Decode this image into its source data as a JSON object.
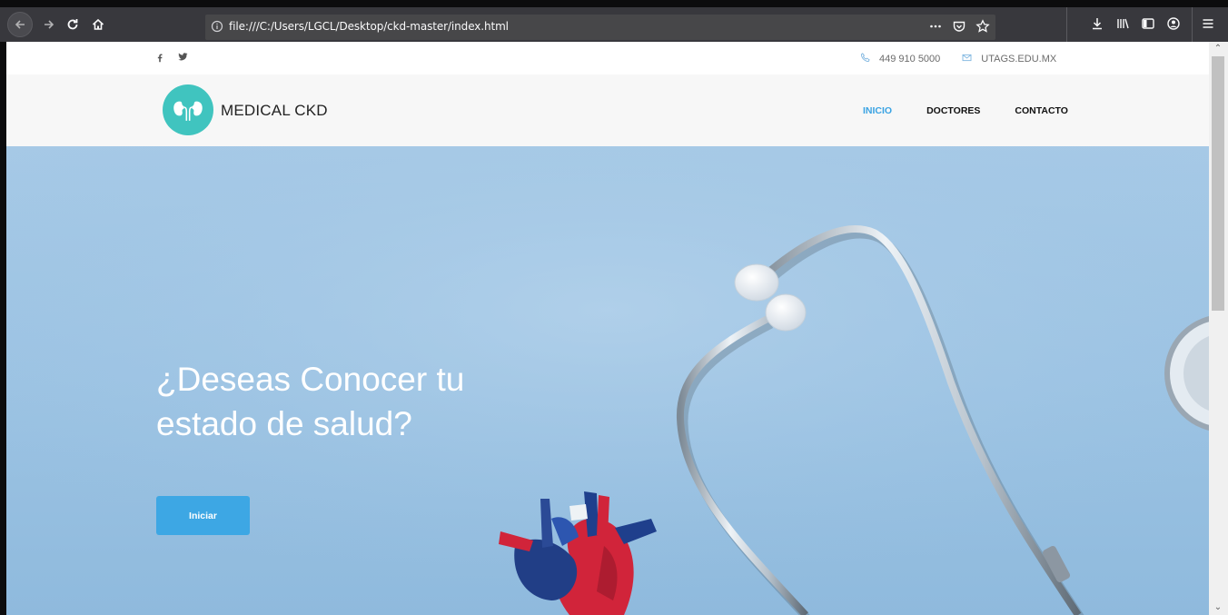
{
  "browser": {
    "url": "file:///C:/Users/LGCL/Desktop/ckd-master/index.html"
  },
  "topbar": {
    "phone": "449 910 5000",
    "email": "UTAGS.EDU.MX"
  },
  "header": {
    "brand": "MEDICAL CKD",
    "nav": [
      {
        "label": "INICIO",
        "active": true
      },
      {
        "label": "DOCTORES",
        "active": false
      },
      {
        "label": "CONTACTO",
        "active": false
      }
    ]
  },
  "hero": {
    "title_line1": "¿Deseas Conocer tu",
    "title_line2": "estado de salud?",
    "button_label": "Iniciar"
  },
  "colors": {
    "accent": "#3da7e4",
    "logo": "#40c4bf",
    "hero_bg": "#9cc3e3"
  }
}
